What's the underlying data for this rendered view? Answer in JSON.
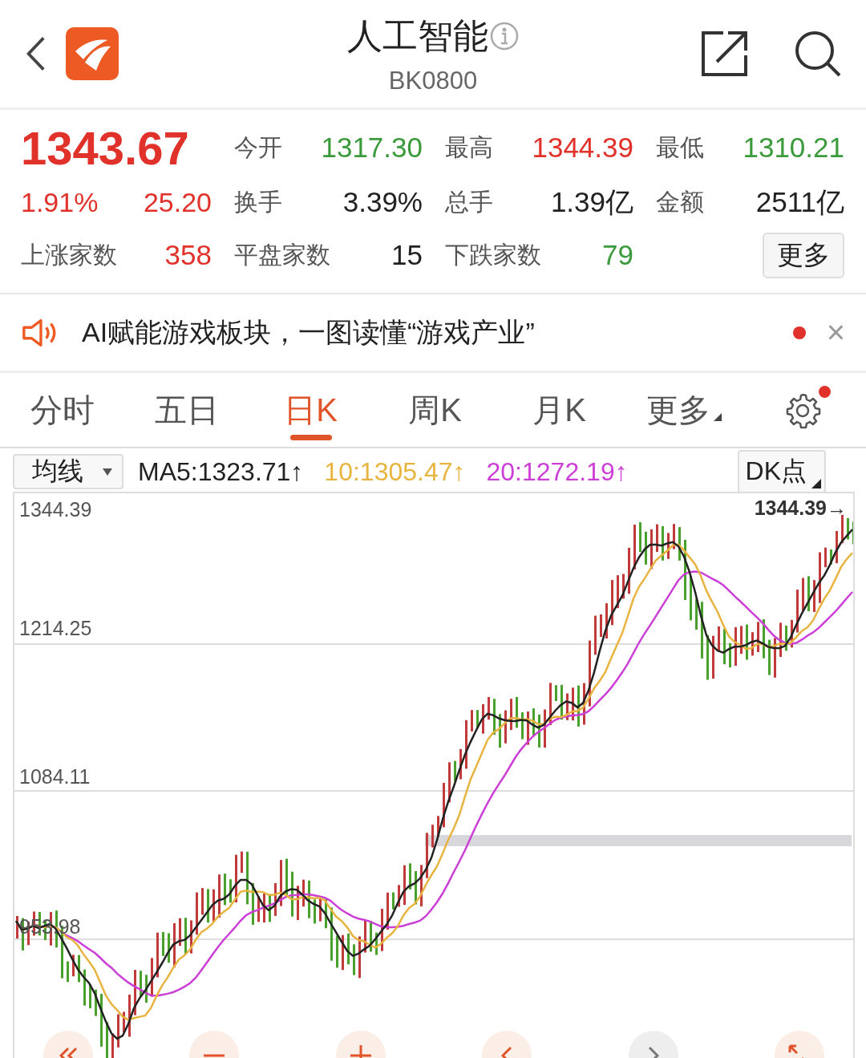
{
  "header": {
    "title": "人工智能",
    "code": "BK0800"
  },
  "quote": {
    "price": "1343.67",
    "change_pct": "1.91%",
    "change": "25.20",
    "color": "#e0312a",
    "fields": [
      {
        "label": "今开",
        "value": "1317.30",
        "color": "#3b9a3b"
      },
      {
        "label": "最高",
        "value": "1344.39",
        "color": "#e0312a"
      },
      {
        "label": "最低",
        "value": "1310.21",
        "color": "#3b9a3b"
      },
      {
        "label": "换手",
        "value": "3.39%",
        "color": "#222222"
      },
      {
        "label": "总手",
        "value": "1.39亿",
        "color": "#222222"
      },
      {
        "label": "金额",
        "value": "2511亿",
        "color": "#222222"
      }
    ],
    "breadth": [
      {
        "label": "上涨家数",
        "value": "358",
        "color": "#e0312a"
      },
      {
        "label": "平盘家数",
        "value": "15",
        "color": "#222222"
      },
      {
        "label": "下跌家数",
        "value": "79",
        "color": "#3b9a3b"
      }
    ],
    "more_button": "更多"
  },
  "news": {
    "text": "AI赋能游戏板块，一图读懂“游戏产业”",
    "unread": true,
    "close": "×"
  },
  "tabs": [
    {
      "label": "分时",
      "selected": false,
      "kind": "text"
    },
    {
      "label": "五日",
      "selected": false,
      "kind": "text"
    },
    {
      "label": "日K",
      "selected": true,
      "kind": "text"
    },
    {
      "label": "周K",
      "selected": false,
      "kind": "text"
    },
    {
      "label": "月K",
      "selected": false,
      "kind": "text"
    },
    {
      "label": "更多",
      "selected": false,
      "kind": "menu"
    }
  ],
  "settings": {
    "badge": true
  },
  "indicator_bar": {
    "dropdown": "均线",
    "dk_button": "DK点",
    "ma": [
      {
        "label": "MA5:1323.71",
        "arrow": "↑",
        "color": "#222222"
      },
      {
        "label": "10:1305.47",
        "arrow": "↑",
        "color": "#e8b440"
      },
      {
        "label": "20:1272.19",
        "arrow": "↑",
        "color": "#cc3fd6"
      }
    ]
  },
  "chart": {
    "y_labels": [
      "1344.39",
      "1214.25",
      "1084.11",
      "953.98"
    ],
    "high_marker": "1344.39→",
    "controls": [
      {
        "kind": "rewind",
        "disabled": false
      },
      {
        "kind": "zoom-out",
        "disabled": false
      },
      {
        "kind": "zoom-in",
        "disabled": false
      },
      {
        "kind": "prev",
        "disabled": false
      },
      {
        "kind": "next",
        "disabled": true
      },
      {
        "kind": "fullscreen",
        "disabled": false
      }
    ]
  }
}
